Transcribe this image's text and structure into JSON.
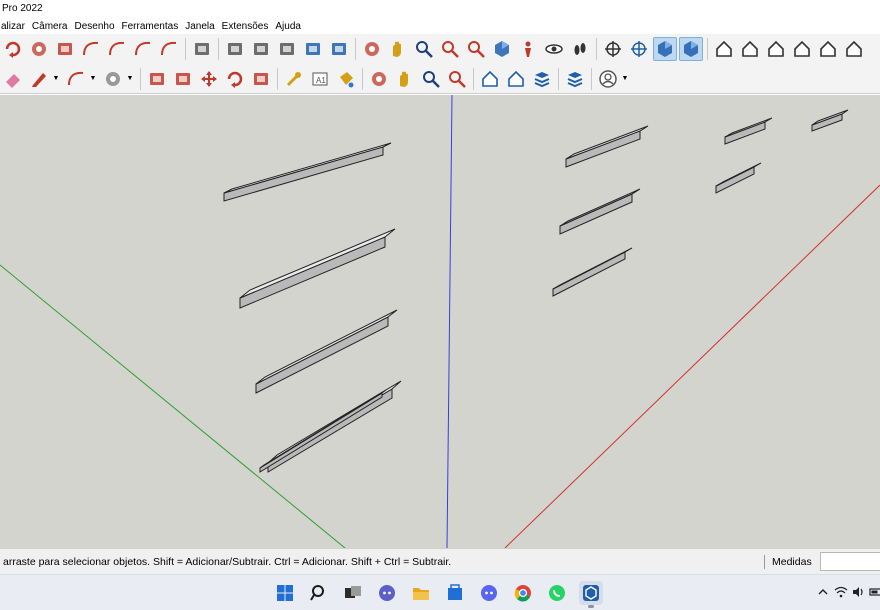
{
  "window": {
    "title": "Pro 2022"
  },
  "menu": [
    "alizar",
    "Câmera",
    "Desenho",
    "Ferramentas",
    "Janela",
    "Extensões",
    "Ajuda"
  ],
  "toolbar1": [
    {
      "name": "rotate-rect-icon",
      "color": "#c0392b"
    },
    {
      "name": "circle-icon",
      "color": "#c0392b"
    },
    {
      "name": "polygon-icon",
      "color": "#c0392b"
    },
    {
      "name": "arc-icon",
      "color": "#c0392b"
    },
    {
      "name": "2-point-arc-icon",
      "color": "#c0392b"
    },
    {
      "name": "3-point-arc-icon",
      "color": "#c0392b"
    },
    {
      "name": "pie-icon",
      "color": "#c0392b"
    },
    {
      "name": "sep"
    },
    {
      "name": "push-pull-icon",
      "color": "#555555"
    },
    {
      "name": "sep"
    },
    {
      "name": "follow-me-icon",
      "color": "#555555"
    },
    {
      "name": "scale-icon",
      "color": "#555555"
    },
    {
      "name": "offset-icon",
      "color": "#555555"
    },
    {
      "name": "intersect-icon",
      "color": "#1f5fae"
    },
    {
      "name": "outer-shell-icon",
      "color": "#1f5fae"
    },
    {
      "name": "sep"
    },
    {
      "name": "orbit-icon",
      "color": "#c0392b"
    },
    {
      "name": "pan-icon",
      "color": "#d4a017"
    },
    {
      "name": "zoom-icon",
      "color": "#1f3f7a"
    },
    {
      "name": "zoom-window-icon",
      "color": "#c0392b"
    },
    {
      "name": "zoom-extents-icon",
      "color": "#c0392b"
    },
    {
      "name": "previous-view-icon",
      "color": "#1f5fae"
    },
    {
      "name": "position-camera-icon",
      "color": "#c0392b"
    },
    {
      "name": "look-around-icon",
      "color": "#333333"
    },
    {
      "name": "walk-icon",
      "color": "#333333"
    },
    {
      "name": "sep"
    },
    {
      "name": "section-plane-icon",
      "color": "#333333"
    },
    {
      "name": "section-display-icon",
      "color": "#1f5fae"
    },
    {
      "name": "iso-view-icon",
      "color": "#1f5fae",
      "active": true
    },
    {
      "name": "top-view-icon",
      "color": "#1f5fae",
      "active": true
    },
    {
      "name": "sep"
    },
    {
      "name": "xray-style-icon",
      "color": "#333333"
    },
    {
      "name": "wireframe-style-icon",
      "color": "#333333"
    },
    {
      "name": "hidden-line-style-icon",
      "color": "#333333"
    },
    {
      "name": "shaded-style-icon",
      "color": "#333333"
    },
    {
      "name": "house-outline-icon",
      "color": "#333333"
    },
    {
      "name": "monochrome-icon",
      "color": "#333333"
    }
  ],
  "toolbar2": [
    {
      "name": "eraser-icon",
      "color": "#e07aa5"
    },
    {
      "name": "pencil-icon",
      "color": "#c0392b",
      "dropdown": true
    },
    {
      "name": "arc-tool-icon",
      "color": "#c0392b",
      "dropdown": true
    },
    {
      "name": "circle-tool-icon",
      "color": "#7a7a7a",
      "dropdown": true
    },
    {
      "name": "sep"
    },
    {
      "name": "push-pull-tool-icon",
      "color": "#c0392b"
    },
    {
      "name": "follow-me-tool-icon",
      "color": "#c0392b"
    },
    {
      "name": "move-icon",
      "color": "#c0392b"
    },
    {
      "name": "rotate-icon",
      "color": "#c0392b"
    },
    {
      "name": "scale-tool-icon",
      "color": "#c0392b"
    },
    {
      "name": "sep"
    },
    {
      "name": "tape-measure-icon",
      "color": "#d4a017"
    },
    {
      "name": "text-icon",
      "color": "#555555"
    },
    {
      "name": "paint-bucket-icon",
      "color": "#d4a017"
    },
    {
      "name": "sep"
    },
    {
      "name": "orbit-tool-icon",
      "color": "#c0392b"
    },
    {
      "name": "pan-tool-icon",
      "color": "#d4a017"
    },
    {
      "name": "zoom-tool-icon",
      "color": "#1f3f7a"
    },
    {
      "name": "zoom-extents-tool-icon",
      "color": "#c0392b"
    },
    {
      "name": "sep"
    },
    {
      "name": "warehouse-icon",
      "color": "#1f5fae"
    },
    {
      "name": "extension-warehouse-icon",
      "color": "#1f5fae"
    },
    {
      "name": "layers-icon",
      "color": "#1f5fae"
    },
    {
      "name": "sep"
    },
    {
      "name": "extension-manager-icon",
      "color": "#1f5fae"
    },
    {
      "name": "sep"
    },
    {
      "name": "account-icon",
      "color": "#555555",
      "dropdown": true
    }
  ],
  "status": {
    "message": "arraste para selecionar objetos. Shift = Adicionar/Subtrair. Ctrl = Adicionar. Shift + Ctrl = Subtrair.",
    "measurements_label": "Medidas",
    "measurements_value": ""
  },
  "taskbar": [
    {
      "name": "start-icon",
      "color": "#1f6fd6"
    },
    {
      "name": "search-icon",
      "color": "#1c1c1c"
    },
    {
      "name": "task-view-icon",
      "color": "#1c1c1c"
    },
    {
      "name": "teams-icon",
      "color": "#5b5fc7"
    },
    {
      "name": "file-explorer-icon",
      "color": "#e9a81c"
    },
    {
      "name": "store-icon",
      "color": "#1f6fd6"
    },
    {
      "name": "discord-icon",
      "color": "#5865f2"
    },
    {
      "name": "chrome-icon",
      "color": "#db4437"
    },
    {
      "name": "whatsapp-icon",
      "color": "#25d366"
    },
    {
      "name": "sketchup-icon",
      "color": "#1f5fae",
      "active": true
    }
  ],
  "tray": [
    {
      "name": "chevron-up-icon"
    },
    {
      "name": "wifi-icon"
    },
    {
      "name": "volume-icon"
    },
    {
      "name": "battery-icon"
    }
  ],
  "scene": {
    "axis_colors": {
      "blue": "#3c3cdc",
      "green": "#2ea02e",
      "red": "#d03232"
    },
    "background": "#d4d4cf",
    "model_face": "#eaeaea",
    "model_edge": "#222222"
  }
}
